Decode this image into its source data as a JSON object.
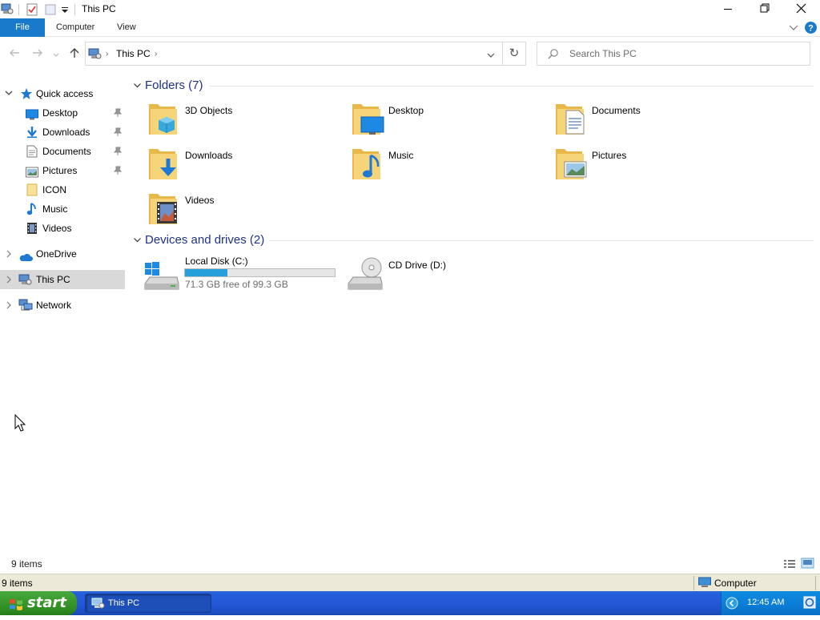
{
  "window": {
    "title": "This PC"
  },
  "ribbon": {
    "tabs": [
      "File",
      "Computer",
      "View"
    ]
  },
  "address": {
    "path": "This PC",
    "search_placeholder": "Search This PC"
  },
  "nav": {
    "quick_access": "Quick access",
    "pinned": [
      "Desktop",
      "Downloads",
      "Documents",
      "Pictures"
    ],
    "unpinned": [
      "ICON",
      "Music",
      "Videos"
    ],
    "onedrive": "OneDrive",
    "this_pc": "This PC",
    "network": "Network"
  },
  "groups": {
    "folders": "Folders (7)",
    "devices": "Devices and drives (2)"
  },
  "folders": [
    "3D Objects",
    "Desktop",
    "Documents",
    "Downloads",
    "Music",
    "Pictures",
    "Videos"
  ],
  "drives": {
    "c": {
      "label": "Local Disk (C:)",
      "free_text": "71.3 GB free of 99.3 GB",
      "used_fraction": 0.282
    },
    "d": {
      "label": "CD Drive (D:)"
    }
  },
  "status": {
    "item_count": "9 items"
  },
  "xp_status": {
    "item_count": "9 items",
    "zone": "Computer"
  },
  "taskbar": {
    "start": "start",
    "task": "This PC",
    "clock": "12:45 AM"
  },
  "colors": {
    "accent": "#1979ca",
    "group_heading": "#1e3287",
    "drive_bar": "#26a0da",
    "folder": "#f2c65c"
  }
}
